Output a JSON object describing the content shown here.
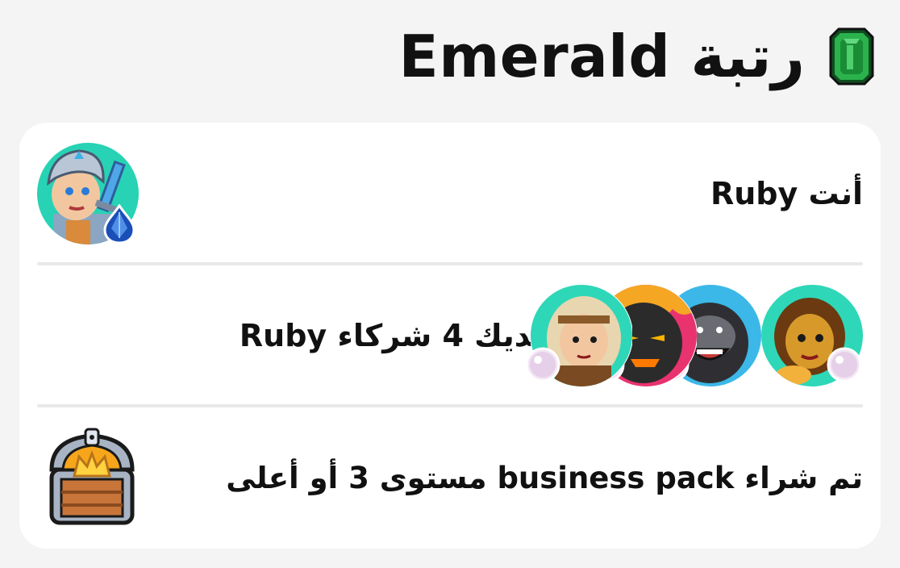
{
  "header": {
    "title": "رتبة Emerald",
    "icon": "emerald-gem-icon",
    "gem_color": "#1f8f3a"
  },
  "requirements": [
    {
      "text": "أنت Ruby",
      "icon": "knight-avatar-icon",
      "badge": "sapphire-gem-icon"
    },
    {
      "text": "لديك 4 شركاء Ruby",
      "avatars": [
        {
          "icon": "woman-avatar-icon",
          "badge": "pearl-icon"
        },
        {
          "icon": "gorilla-avatar-icon",
          "badge": "pearl-icon"
        },
        {
          "icon": "lava-monster-avatar-icon",
          "badge": "pearl-icon"
        },
        {
          "icon": "warrior-woman-avatar-icon",
          "badge": "pearl-icon"
        }
      ]
    },
    {
      "text": "تم شراء business pack مستوى 3 أو أعلى",
      "icon": "treasure-chest-icon"
    }
  ],
  "colors": {
    "background": "#f4f4f4",
    "card": "#ffffff",
    "divider": "#e9e9e9",
    "text": "#111111"
  }
}
